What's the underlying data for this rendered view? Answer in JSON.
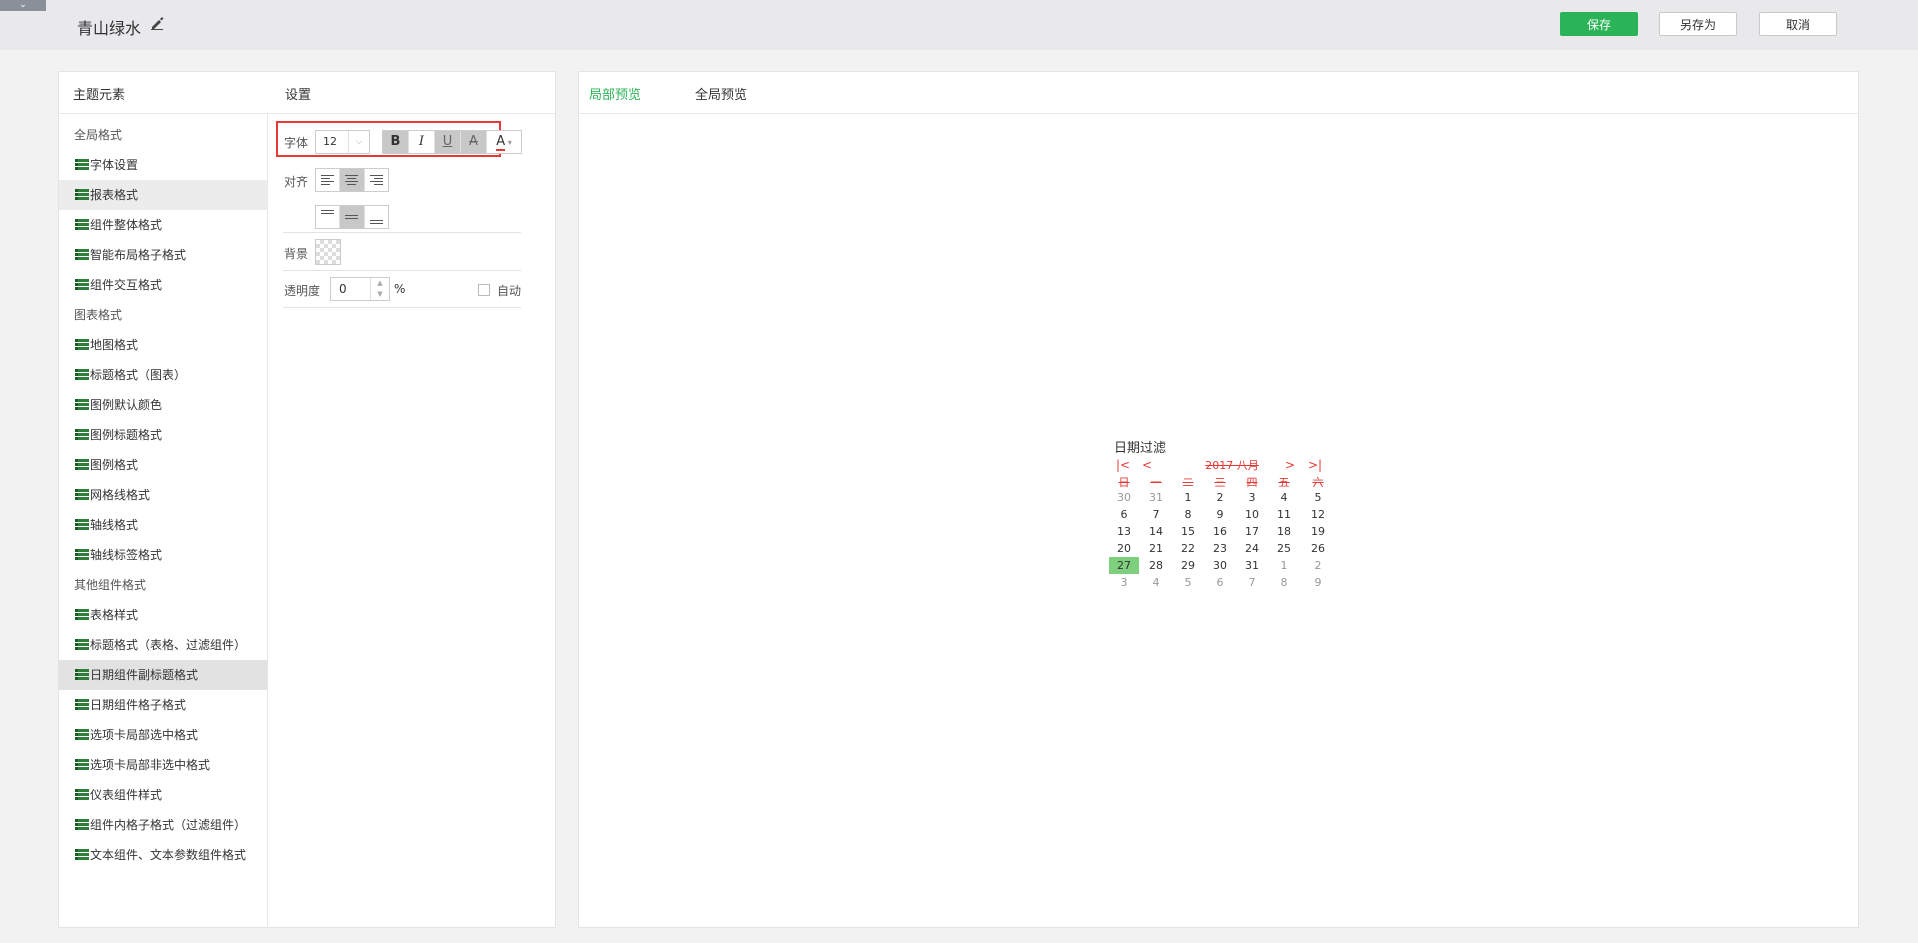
{
  "header": {
    "title": "青山绿水",
    "buttons": {
      "save": "保存",
      "save_as": "另存为",
      "cancel": "取消"
    }
  },
  "left_panel": {
    "heading_elements": "主题元素",
    "heading_settings": "设置",
    "tree": [
      {
        "label": "全局格式",
        "type": "group"
      },
      {
        "label": "字体设置",
        "type": "leaf"
      },
      {
        "label": "报表格式",
        "type": "leaf",
        "state": "hover"
      },
      {
        "label": "组件整体格式",
        "type": "leaf"
      },
      {
        "label": "智能布局格子格式",
        "type": "leaf"
      },
      {
        "label": "组件交互格式",
        "type": "leaf"
      },
      {
        "label": "图表格式",
        "type": "group"
      },
      {
        "label": "地图格式",
        "type": "leaf"
      },
      {
        "label": "标题格式（图表）",
        "type": "leaf"
      },
      {
        "label": "图例默认颜色",
        "type": "leaf"
      },
      {
        "label": "图例标题格式",
        "type": "leaf"
      },
      {
        "label": "图例格式",
        "type": "leaf"
      },
      {
        "label": "网格线格式",
        "type": "leaf"
      },
      {
        "label": "轴线格式",
        "type": "leaf"
      },
      {
        "label": "轴线标签格式",
        "type": "leaf"
      },
      {
        "label": "其他组件格式",
        "type": "group"
      },
      {
        "label": "表格样式",
        "type": "leaf"
      },
      {
        "label": "标题格式（表格、过滤组件）",
        "type": "leaf"
      },
      {
        "label": "日期组件副标题格式",
        "type": "leaf",
        "state": "selected"
      },
      {
        "label": "日期组件格子格式",
        "type": "leaf"
      },
      {
        "label": "选项卡局部选中格式",
        "type": "leaf"
      },
      {
        "label": "选项卡局部非选中格式",
        "type": "leaf"
      },
      {
        "label": "仪表组件样式",
        "type": "leaf"
      },
      {
        "label": "组件内格子格式（过滤组件）",
        "type": "leaf"
      },
      {
        "label": "文本组件、文本参数组件格式",
        "type": "leaf"
      }
    ],
    "settings": {
      "font_label": "字体",
      "font_size": "12",
      "style_buttons": {
        "bold": "B",
        "italic": "I",
        "underline": "U",
        "strike": "A",
        "color": "A"
      },
      "align_label": "对齐",
      "background_label": "背景",
      "opacity_label": "透明度",
      "opacity_value": "0",
      "opacity_unit": "%",
      "auto_label": "自动"
    }
  },
  "right_panel": {
    "tabs": [
      "局部预览",
      "全局预览"
    ],
    "calendar": {
      "title": "日期过滤",
      "month_label": "2017 八月",
      "nav": {
        "first": "|<",
        "prev": "<",
        "next": ">",
        "last": ">|"
      },
      "weekdays": [
        "日",
        "一",
        "二",
        "三",
        "四",
        "五",
        "六"
      ],
      "weeks": [
        [
          "30",
          "31",
          "1",
          "2",
          "3",
          "4",
          "5"
        ],
        [
          "6",
          "7",
          "8",
          "9",
          "10",
          "11",
          "12"
        ],
        [
          "13",
          "14",
          "15",
          "16",
          "17",
          "18",
          "19"
        ],
        [
          "20",
          "21",
          "22",
          "23",
          "24",
          "25",
          "26"
        ],
        [
          "27",
          "28",
          "29",
          "30",
          "31",
          "1",
          "2"
        ],
        [
          "3",
          "4",
          "5",
          "6",
          "7",
          "8",
          "9"
        ]
      ],
      "today": "27"
    }
  },
  "colors": {
    "accent": "#2bb457",
    "highlight_border": "#e53935",
    "today_bg": "#7ecf7e"
  }
}
